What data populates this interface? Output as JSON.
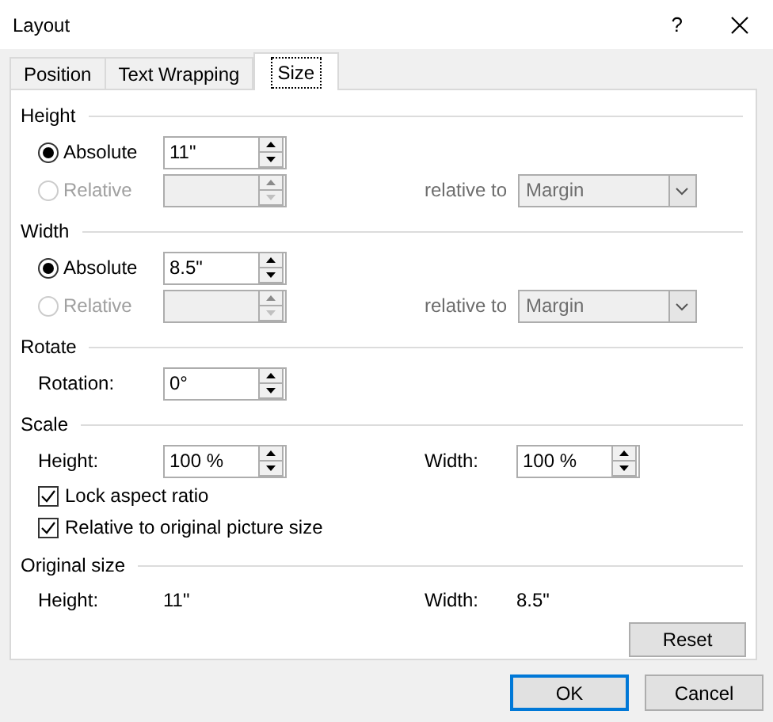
{
  "window": {
    "title": "Layout",
    "help": "?"
  },
  "tabs": [
    {
      "label": "Position",
      "selected": false
    },
    {
      "label": "Text Wrapping",
      "selected": false
    },
    {
      "label": "Size",
      "selected": true
    }
  ],
  "sections": [
    {
      "title": "Height",
      "rows": [
        {
          "kind": "radio",
          "label": "Absolute",
          "selected": true,
          "disabled": false,
          "value": "11\""
        },
        {
          "kind": "radio",
          "label": "Relative",
          "selected": false,
          "disabled": true,
          "relative_label": "relative to",
          "relative_value": "Margin"
        }
      ]
    },
    {
      "title": "Width",
      "rows": [
        {
          "kind": "radio",
          "label": "Absolute",
          "selected": true,
          "disabled": false,
          "value": "8.5\""
        },
        {
          "kind": "radio",
          "label": "Relative",
          "selected": false,
          "disabled": true,
          "relative_label": "relative to",
          "relative_value": "Margin"
        }
      ]
    },
    {
      "title": "Rotate",
      "rows": [
        {
          "kind": "spin",
          "label": "Rotation:",
          "value": "0°"
        }
      ]
    },
    {
      "title": "Scale",
      "rows": [
        {
          "kind": "spin",
          "label": "Height:",
          "value": "100 %",
          "label_2": "Width:",
          "value_2": "100 %"
        },
        {
          "kind": "checkbox",
          "label": "Lock aspect ratio",
          "checked": true
        },
        {
          "kind": "checkbox",
          "label": "Relative to original picture size",
          "checked": true
        }
      ]
    },
    {
      "title": "Original size",
      "rows": [
        {
          "kind": "info",
          "label": "Height:",
          "value": "11\"",
          "label_2": "Width:",
          "value_2": "8.5\""
        },
        {
          "kind": "button",
          "label": "Reset"
        }
      ]
    }
  ],
  "buttons": [
    {
      "label": "OK",
      "default": true
    },
    {
      "label": "Cancel",
      "default": false
    }
  ]
}
